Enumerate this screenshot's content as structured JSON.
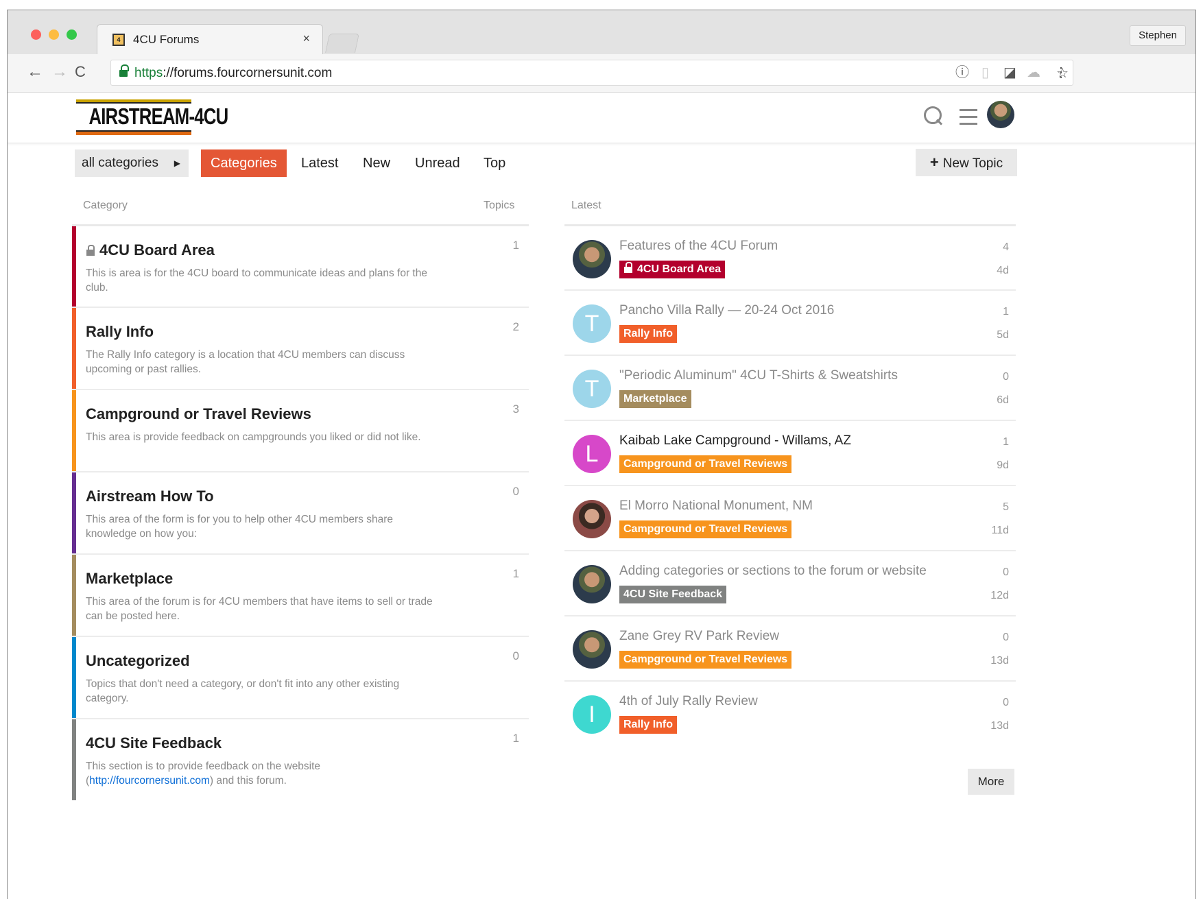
{
  "browser": {
    "tab_title": "4CU Forums",
    "tab_close": "×",
    "profile_name": "Stephen",
    "url_scheme": "https",
    "url_rest": "://forums.fourcornersunit.com",
    "back": "←",
    "forward": "→",
    "reload": "C",
    "star": "☆",
    "menu": "⋮"
  },
  "site": {
    "logo_text": "AIRSTREAM-4CU"
  },
  "nav": {
    "dropdown_label": "all categories",
    "dropdown_caret": "▶",
    "items": [
      "Categories",
      "Latest",
      "New",
      "Unread",
      "Top"
    ],
    "active": "Categories",
    "new_topic_plus": "+",
    "new_topic_label": "New Topic"
  },
  "columns": {
    "category": "Category",
    "topics": "Topics",
    "latest": "Latest"
  },
  "categories": [
    {
      "name": "4CU Board Area",
      "locked": true,
      "color": "#b3002d",
      "topics": "1",
      "description": "This is area is for the 4CU board to communicate ideas and plans for the club."
    },
    {
      "name": "Rally Info",
      "locked": false,
      "color": "#f15f2a",
      "topics": "2",
      "description": "The Rally Info category is a location that 4CU members can discuss upcoming or past rallies."
    },
    {
      "name": "Campground or Travel Reviews",
      "locked": false,
      "color": "#f7941d",
      "topics": "3",
      "description": "This area is provide feedback on campgrounds you liked or did not like."
    },
    {
      "name": "Airstream How To",
      "locked": false,
      "color": "#652d90",
      "topics": "0",
      "description": "This area of the form is for you to help other 4CU members share knowledge on how you:"
    },
    {
      "name": "Marketplace",
      "locked": false,
      "color": "#a48c5e",
      "topics": "1",
      "description": "This area of the forum is for 4CU members that have items to sell or trade can be posted here."
    },
    {
      "name": "Uncategorized",
      "locked": false,
      "color": "#0088cc",
      "topics": "0",
      "description": "Topics that don't need a category, or don't fit into any other existing category."
    },
    {
      "name": "4CU Site Feedback",
      "locked": false,
      "color": "#808281",
      "topics": "1",
      "description_prefix": "This section is to provide feedback on the website (",
      "description_link": "http://fourcornersunit.com",
      "description_suffix": ") and this forum."
    }
  ],
  "latest": [
    {
      "title": "Features of the 4CU Forum",
      "category": "4CU Board Area",
      "locked": true,
      "badge_color": "#b3002d",
      "posts": "4",
      "age": "4d",
      "avatar": "photo",
      "avatar_letter": "",
      "unread": false
    },
    {
      "title": "Pancho Villa Rally — 20-24 Oct 2016",
      "category": "Rally Info",
      "locked": false,
      "badge_color": "#f15f2a",
      "posts": "1",
      "age": "5d",
      "avatar": "letter",
      "avatar_letter": "T",
      "avatar_color": "#9dd6ea",
      "unread": false
    },
    {
      "title": "\"Periodic Aluminum\" 4CU T-Shirts & Sweatshirts",
      "category": "Marketplace",
      "locked": false,
      "badge_color": "#a48c5e",
      "posts": "0",
      "age": "6d",
      "avatar": "letter",
      "avatar_letter": "T",
      "avatar_color": "#9dd6ea",
      "unread": false
    },
    {
      "title": "Kaibab Lake Campground - Willams, AZ",
      "category": "Campground or Travel Reviews",
      "locked": false,
      "badge_color": "#f7941d",
      "posts": "1",
      "age": "9d",
      "avatar": "letter",
      "avatar_letter": "L",
      "avatar_color": "#d748c9",
      "unread": true
    },
    {
      "title": "El Morro National Monument, NM",
      "category": "Campground or Travel Reviews",
      "locked": false,
      "badge_color": "#f7941d",
      "posts": "5",
      "age": "11d",
      "avatar": "photo2",
      "avatar_letter": "",
      "unread": false
    },
    {
      "title": "Adding categories or sections to the forum or website",
      "category": "4CU Site Feedback",
      "locked": false,
      "badge_color": "#808281",
      "posts": "0",
      "age": "12d",
      "avatar": "photo",
      "avatar_letter": "",
      "unread": false
    },
    {
      "title": "Zane Grey RV Park Review",
      "category": "Campground or Travel Reviews",
      "locked": false,
      "badge_color": "#f7941d",
      "posts": "0",
      "age": "13d",
      "avatar": "photo",
      "avatar_letter": "",
      "unread": false
    },
    {
      "title": "4th of July Rally Review",
      "category": "Rally Info",
      "locked": false,
      "badge_color": "#f15f2a",
      "posts": "0",
      "age": "13d",
      "avatar": "letter",
      "avatar_letter": "I",
      "avatar_color": "#3ed8d0",
      "unread": false
    }
  ],
  "more_label": "More"
}
